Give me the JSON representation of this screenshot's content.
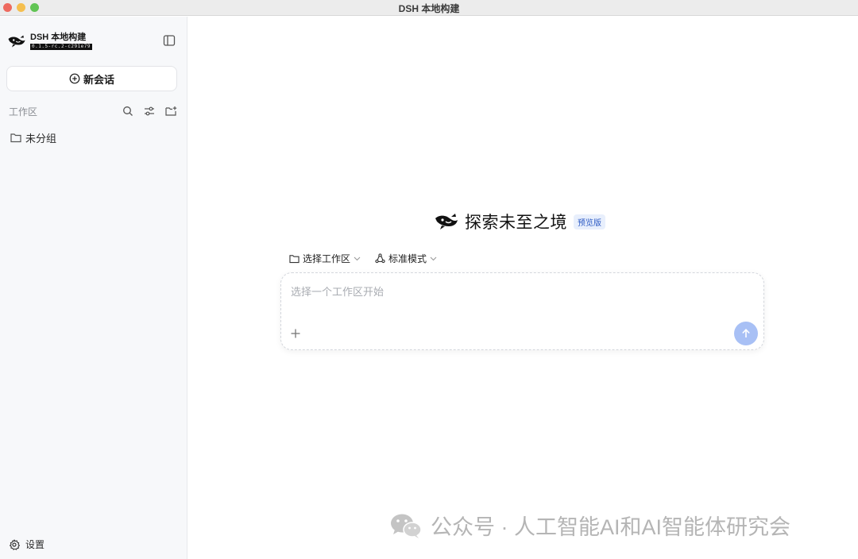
{
  "window": {
    "title": "DSH 本地构建"
  },
  "sidebar": {
    "brand_name": "DSH 本地构建",
    "version": "0.1.5-rc.2-c291e79",
    "new_chat_label": "新会话",
    "workspace_label": "工作区",
    "groups": [
      {
        "label": "未分组"
      }
    ],
    "settings_label": "设置"
  },
  "main": {
    "hero_title": "探索未至之境",
    "badge": "预览版",
    "workspace_select_label": "选择工作区",
    "mode_select_label": "标准模式",
    "composer": {
      "placeholder": "选择一个工作区开始"
    }
  },
  "watermark": {
    "text": "公众号 · 人工智能AI和AI智能体研究会"
  },
  "colors": {
    "accent": "#a8c0f5",
    "badge_text": "#2b59c3",
    "badge_bg": "#e8effc"
  },
  "icons": [
    "logo-icon",
    "sidebar-toggle-icon",
    "plus-circle-icon",
    "search-icon",
    "sliders-icon",
    "new-folder-icon",
    "folder-icon",
    "gear-icon",
    "chevron-down-icon",
    "mode-icon",
    "plus-icon",
    "arrow-up-icon",
    "wechat-icon"
  ]
}
